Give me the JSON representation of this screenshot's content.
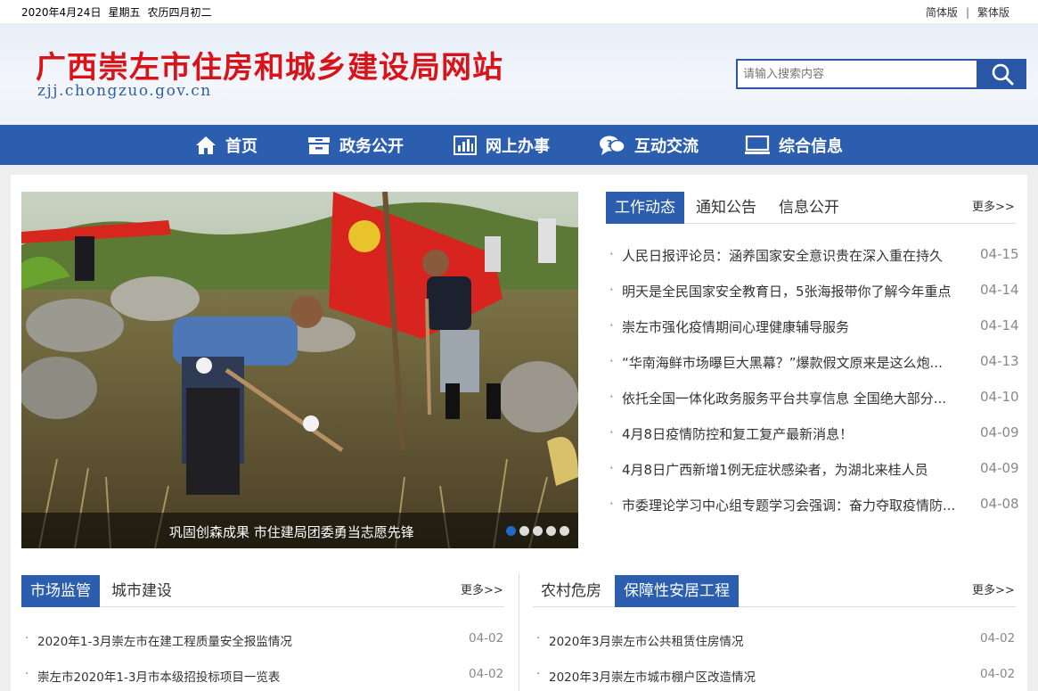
{
  "topbar": {
    "date": "2020年4月24日",
    "weekday": "星期五",
    "lunar": "农历四月初二",
    "simplified": "简体版",
    "separator": "|",
    "traditional": "繁体版"
  },
  "header": {
    "title": "广西崇左市住房和城乡建设局网站",
    "domain": "zjj.chongzuo.gov.cn",
    "search_placeholder": "请输入搜索内容"
  },
  "nav": [
    {
      "label": "首页",
      "icon": "home-icon"
    },
    {
      "label": "政务公开",
      "icon": "archive-icon"
    },
    {
      "label": "网上办事",
      "icon": "bar-chart-icon"
    },
    {
      "label": "互动交流",
      "icon": "chat-icon"
    },
    {
      "label": "综合信息",
      "icon": "monitor-icon"
    }
  ],
  "slider": {
    "caption": "巩固创森成果 市住建局团委勇当志愿先锋",
    "dot_count": 5,
    "active_dot": 0
  },
  "news": {
    "tabs": [
      "工作动态",
      "通知公告",
      "信息公开"
    ],
    "more": "更多>>",
    "items": [
      {
        "title": "人民日报评论员：涵养国家安全意识贵在深入重在持久",
        "date": "04-15"
      },
      {
        "title": "明天是全民国家安全教育日，5张海报带你了解今年重点",
        "date": "04-14"
      },
      {
        "title": "崇左市强化疫情期间心理健康辅导服务",
        "date": "04-14"
      },
      {
        "title": "“华南海鲜市场曝巨大黑幕？”爆款假文原来是这么炮...",
        "date": "04-13"
      },
      {
        "title": "依托全国一体化政务服务平台共享信息 全国绝大部分...",
        "date": "04-10"
      },
      {
        "title": "4月8日疫情防控和复工复产最新消息！",
        "date": "04-09"
      },
      {
        "title": "4月8日广西新增1例无症状感染者，为湖北来桂人员",
        "date": "04-09"
      },
      {
        "title": "市委理论学习中心组专题学习会强调：奋力夺取疫情防...",
        "date": "04-08"
      }
    ]
  },
  "market": {
    "tabs": [
      "市场监管",
      "城市建设"
    ],
    "more": "更多>>",
    "items": [
      {
        "title": "2020年1-3月崇左市在建工程质量安全报监情况",
        "date": "04-02"
      },
      {
        "title": "崇左市2020年1-3月市本级招投标项目一览表",
        "date": "04-02"
      }
    ]
  },
  "housing": {
    "tabs": [
      "农村危房",
      "保障性安居工程"
    ],
    "more": "更多>>",
    "items": [
      {
        "title": "2020年3月崇左市公共租赁住房情况",
        "date": "04-02"
      },
      {
        "title": "2020年3月崇左市城市棚户区改造情况",
        "date": "04-02"
      }
    ]
  },
  "colors": {
    "brand_blue": "#2c5eb0",
    "title_red": "#d8141a",
    "active_dot": "#1f6ac6"
  }
}
